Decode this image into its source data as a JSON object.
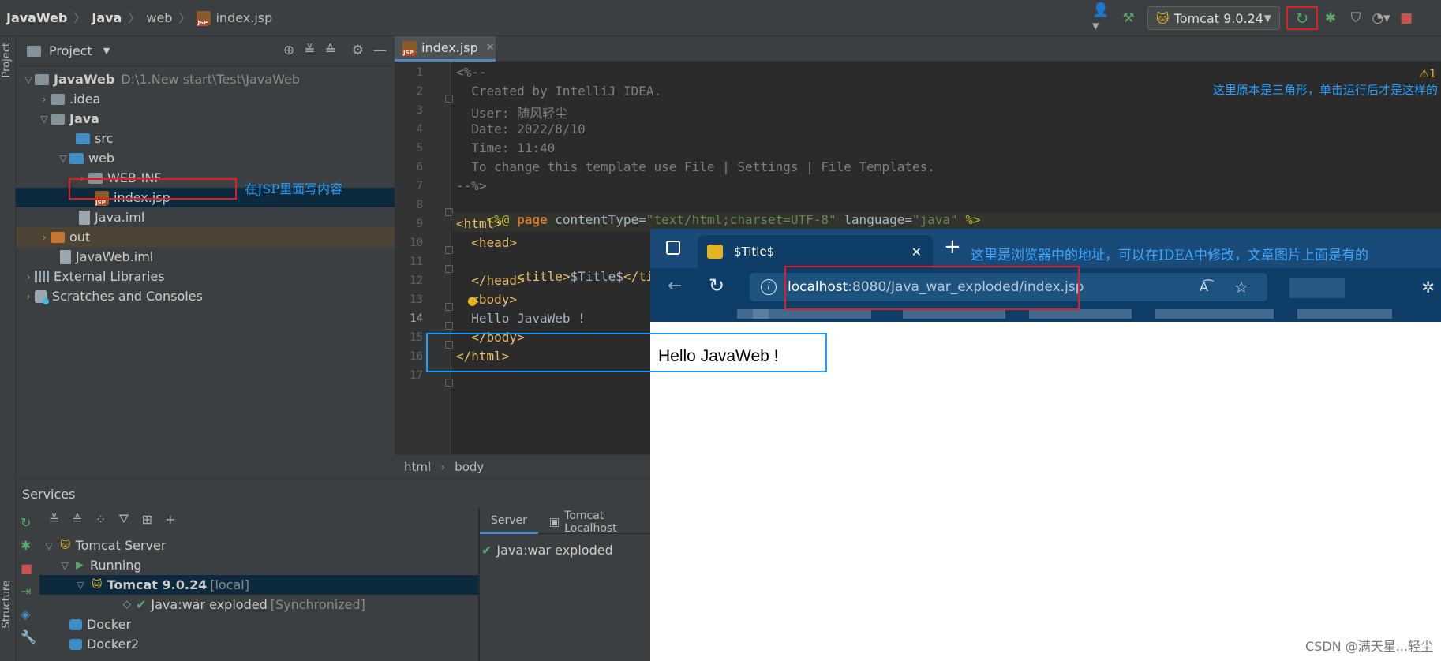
{
  "breadcrumb": [
    "JavaWeb",
    "Java",
    "web",
    "index.jsp"
  ],
  "run_config": {
    "label": "Tomcat 9.0.24"
  },
  "annotations": {
    "top_right": "这里原本是三角形，单击运行后才是这样的",
    "jsp_note": "在JSP里面写内容",
    "browser_note": "这里是浏览器中的地址，可以在IDEA中修改，文章图片上面是有的"
  },
  "left_strip": {
    "project": "Project",
    "structure": "Structure"
  },
  "project_panel": {
    "title": "Project",
    "tree": [
      {
        "label": "JavaWeb",
        "hint": "D:\\1.New start\\Test\\JavaWeb"
      },
      {
        "label": ".idea"
      },
      {
        "label": "Java"
      },
      {
        "label": "src"
      },
      {
        "label": "web"
      },
      {
        "label": "WEB-INF"
      },
      {
        "label": "index.jsp"
      },
      {
        "label": "Java.iml"
      },
      {
        "label": "out"
      },
      {
        "label": "JavaWeb.iml"
      },
      {
        "label": "External Libraries"
      },
      {
        "label": "Scratches and Consoles"
      }
    ]
  },
  "editor": {
    "tab": "index.jsp",
    "line_numbers": [
      "1",
      "2",
      "3",
      "4",
      "5",
      "6",
      "7",
      "8",
      "9",
      "10",
      "11",
      "12",
      "13",
      "14",
      "15",
      "16",
      "17"
    ],
    "lines": {
      "l1": "<%--",
      "l2": "  Created by IntelliJ IDEA.",
      "l3": "  User: 随风轻尘",
      "l4": "  Date: 2022/8/10",
      "l5": "  Time: 11:40",
      "l6": "  To change this template use File | Settings | File Templates.",
      "l7": "--%>",
      "l8_a": "<%@ ",
      "l8_kw": "page",
      "l8_b": " contentType=",
      "l8_s1": "\"text/html;charset=UTF-8\"",
      "l8_c": " language=",
      "l8_s2": "\"java\"",
      "l8_d": " %>",
      "l9": "<html>",
      "l10": "  <head>",
      "l11_a": "    <title>",
      "l11_b": "$Title$",
      "l11_c": "</title>",
      "l12": "  </head>",
      "l13": "  <body>",
      "l14": "  Hello JavaWeb !",
      "l15": "  </body>",
      "l16": "</html>"
    },
    "crumbs": [
      "html",
      "body"
    ],
    "warning": "⚠1"
  },
  "services": {
    "title": "Services",
    "tree": {
      "tomcat_server": "Tomcat Server",
      "running": "Running",
      "tomcat_version": "Tomcat 9.0.24",
      "tomcat_local": "[local]",
      "artifact": "Java:war exploded",
      "artifact_state": "[Synchronized]",
      "docker": "Docker",
      "docker2": "Docker2"
    },
    "server_tabs": [
      "Server",
      "Tomcat Localhost"
    ],
    "deployment": "Java:war exploded"
  },
  "browser": {
    "tab_title": "$Title$",
    "url_host": "localhost",
    "url_rest": ":8080/Java_war_exploded/index.jsp",
    "page_text": "Hello JavaWeb !"
  },
  "watermark": "CSDN @满天星...轻尘"
}
